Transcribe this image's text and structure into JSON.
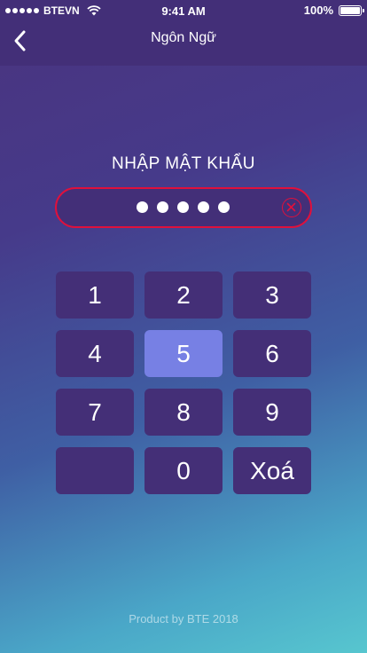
{
  "status_bar": {
    "carrier": "BTEVN",
    "time": "9:41 AM",
    "battery": "100%"
  },
  "nav": {
    "title": "Ngôn Ngữ",
    "back_icon": "chevron-left-icon"
  },
  "pin_entry": {
    "prompt": "NHẬP MẬT KHẨU",
    "entered_count": 5,
    "clear_icon": "close-circle-icon"
  },
  "keypad": {
    "keys": [
      "1",
      "2",
      "3",
      "4",
      "5",
      "6",
      "7",
      "8",
      "9",
      "",
      "0",
      "Xoá"
    ],
    "active_key": "5"
  },
  "footer": {
    "text": "Product by BTE 2018"
  },
  "colors": {
    "header_bg": "#432f78",
    "key_bg": "#442f77",
    "key_active_bg": "#7780e4",
    "error_border": "#e0103c"
  }
}
